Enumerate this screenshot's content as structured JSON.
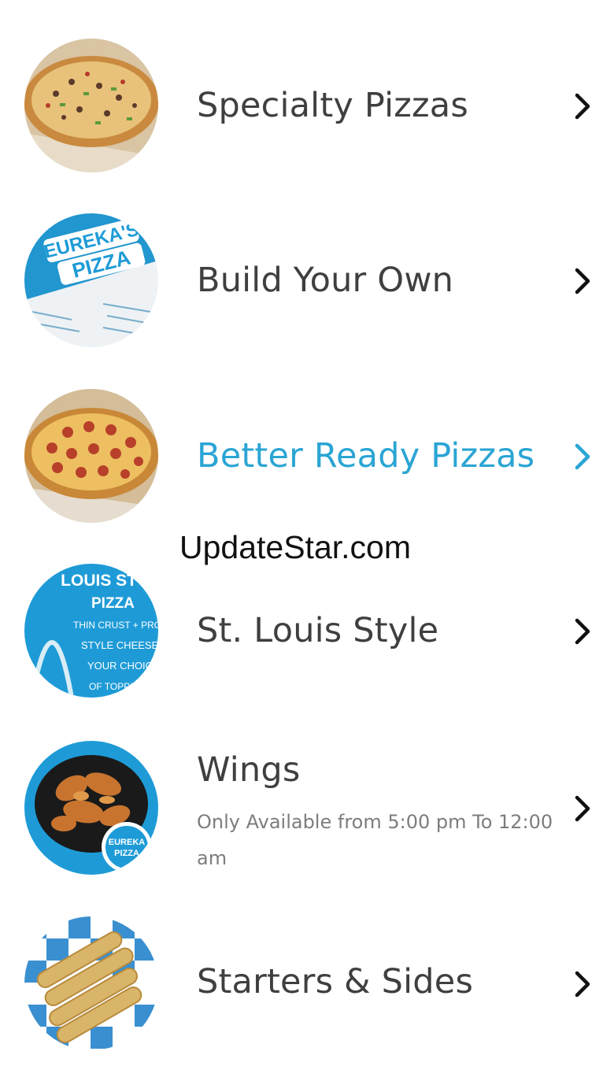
{
  "menu": {
    "items": [
      {
        "title": "Specialty Pizzas",
        "subtitle": "",
        "image_icon": "pizza-supreme-image"
      },
      {
        "title": "Build Your Own",
        "subtitle": "",
        "image_icon": "pizza-box-logo-image"
      },
      {
        "title": "Better Ready Pizzas",
        "subtitle": "",
        "image_icon": "pepperoni-pizza-image",
        "active": true
      },
      {
        "title": "St. Louis Style",
        "subtitle": "",
        "image_icon": "st-louis-style-badge-image"
      },
      {
        "title": "Wings",
        "subtitle": "Only Available from 5:00 pm To 12:00 am",
        "image_icon": "wings-bowl-image"
      },
      {
        "title": "Starters & Sides",
        "subtitle": "",
        "image_icon": "breadsticks-image"
      }
    ],
    "chevron_icon": "chevron-right-icon"
  },
  "badges": {
    "box_brand_top": "EUREKA'S",
    "box_brand_bottom": "PIZZA",
    "st_louis_line1": "LOUIS STYLE",
    "st_louis_line2": "PIZZA",
    "st_louis_line3": "THIN CRUST + PROVEL",
    "st_louis_line4": "STYLE CHEESE",
    "st_louis_line5": "YOUR CHOICE",
    "st_louis_line6": "OF TOPPINGS",
    "wings_logo_top": "EUREKA",
    "wings_logo_bottom": "PIZZA"
  },
  "watermark": "UpdateStar.com",
  "colors": {
    "accent": "#2aa5d4",
    "title_text": "#3f3f3f",
    "subtitle_text": "#7d7d7d",
    "brand_blue": "#1e9bd7"
  }
}
